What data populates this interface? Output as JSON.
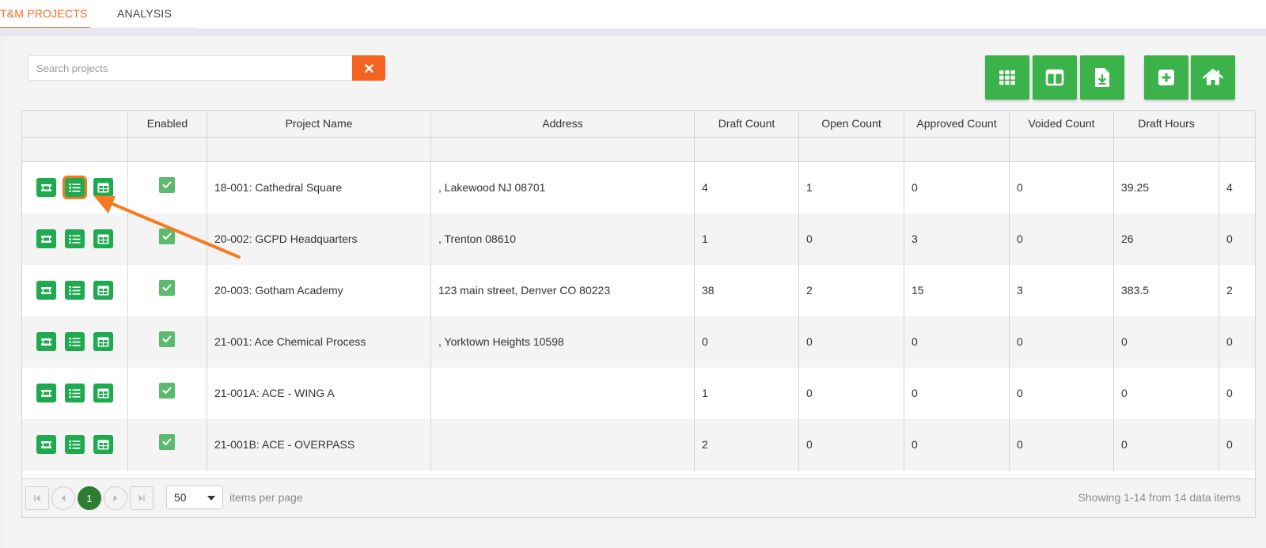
{
  "tabs": [
    {
      "label": "T&M PROJECTS",
      "active": true
    },
    {
      "label": "ANALYSIS",
      "active": false
    }
  ],
  "search": {
    "placeholder": "Search projects",
    "value": ""
  },
  "toolbar": {
    "buttons": [
      {
        "icon": "grid-icon"
      },
      {
        "icon": "columns-icon"
      },
      {
        "icon": "file-download-icon"
      },
      {
        "icon": "plus-square-icon"
      },
      {
        "icon": "home-icon"
      }
    ],
    "color": "#3bb24a"
  },
  "grid": {
    "columns": [
      "",
      "Enabled",
      "Project Name",
      "Address",
      "Draft Count",
      "Open Count",
      "Approved Count",
      "Voided Count",
      "Draft Hours"
    ],
    "rows": [
      {
        "project": "18-001: Cathedral Square",
        "address": ", Lakewood NJ 08701",
        "draft": "4",
        "open": "1",
        "approved": "0",
        "voided": "0",
        "hours": "39.25",
        "next": "4"
      },
      {
        "project": "20-002: GCPD Headquarters",
        "address": ", Trenton 08610",
        "draft": "1",
        "open": "0",
        "approved": "3",
        "voided": "0",
        "hours": "26",
        "next": "0"
      },
      {
        "project": "20-003: Gotham Academy",
        "address": "123 main street, Denver CO 80223",
        "draft": "38",
        "open": "2",
        "approved": "15",
        "voided": "3",
        "hours": "383.5",
        "next": "2"
      },
      {
        "project": "21-001: Ace Chemical Process",
        "address": ", Yorktown Heights 10598",
        "draft": "0",
        "open": "0",
        "approved": "0",
        "voided": "0",
        "hours": "0",
        "next": "0"
      },
      {
        "project": "21-001A: ACE - WING A",
        "address": "",
        "draft": "1",
        "open": "0",
        "approved": "0",
        "voided": "0",
        "hours": "0",
        "next": "0"
      },
      {
        "project": "21-001B: ACE - OVERPASS",
        "address": "",
        "draft": "2",
        "open": "0",
        "approved": "0",
        "voided": "0",
        "hours": "0",
        "next": "0"
      }
    ]
  },
  "pager": {
    "current_page": "1",
    "page_size": "50",
    "items_per_page_label": "items per page",
    "showing_text": "Showing 1-14 from 14 data items"
  },
  "colors": {
    "accent": "#f26b21",
    "green": "#1faa50",
    "highlight": "#f47b20"
  }
}
